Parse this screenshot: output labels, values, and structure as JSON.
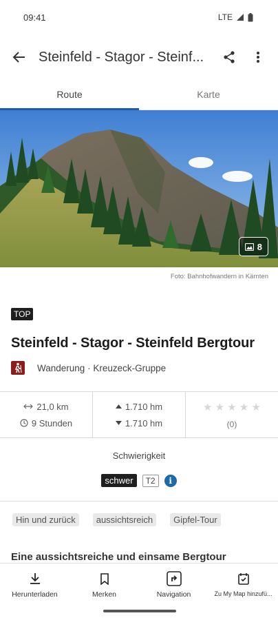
{
  "status": {
    "time": "09:41",
    "network": "LTE"
  },
  "app_bar": {
    "title": "Steinfeld - Stagor - Steinf..."
  },
  "tabs": [
    {
      "label": "Route",
      "active": true
    },
    {
      "label": "Karte",
      "active": false
    }
  ],
  "hero": {
    "photo_count": "8",
    "credit": "Foto: Bahnhofwandern in Kärnten"
  },
  "route": {
    "badge": "TOP",
    "title": "Steinfeld - Stagor - Steinfeld Bergtour",
    "category": "Wanderung",
    "region": "Kreuzeck-Gruppe",
    "separator": "·"
  },
  "stats": {
    "distance": "21,0 km",
    "duration": "9 Stunden",
    "ascent": "1.710 hm",
    "descent": "1.710 hm",
    "rating_count": "(0)",
    "stars": "★ ★ ★ ★ ★"
  },
  "difficulty": {
    "label": "Schwierigkeit",
    "level": "schwer",
    "scale": "T2"
  },
  "tags": [
    "Hin und zurück",
    "aussichtsreich",
    "Gipfel-Tour"
  ],
  "teaser": "Eine aussichtsreiche und einsame Bergtour",
  "bottom_nav": [
    {
      "label": "Herunterladen",
      "icon": "download-icon"
    },
    {
      "label": "Merken",
      "icon": "bookmark-icon"
    },
    {
      "label": "Navigation",
      "icon": "navigation-icon"
    },
    {
      "label": "Zu My Map hinzufü...",
      "icon": "map-add-icon"
    }
  ],
  "colors": {
    "accent": "#1d5aa8",
    "hike_icon": "#8b1d1d",
    "info": "#1d6aa8",
    "badge": "#1f1f1f"
  }
}
